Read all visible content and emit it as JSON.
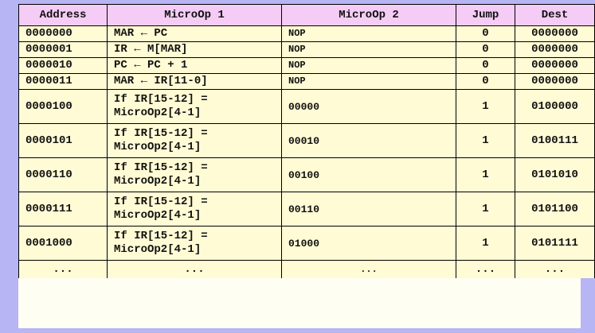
{
  "table": {
    "headers": {
      "address": "Address",
      "microop1": "MicroOp 1",
      "microop2": "MicroOp 2",
      "jump": "Jump",
      "dest": "Dest"
    },
    "rows": [
      {
        "address": "0000000",
        "microop1": "MAR ← PC",
        "microop2": "NOP",
        "jump": "0",
        "dest": "0000000"
      },
      {
        "address": "0000001",
        "microop1": "IR ← M[MAR]",
        "microop2": "NOP",
        "jump": "0",
        "dest": "0000000"
      },
      {
        "address": "0000010",
        "microop1": "PC ← PC + 1",
        "microop2": "NOP",
        "jump": "0",
        "dest": "0000000"
      },
      {
        "address": "0000011",
        "microop1": "MAR ← IR[11-0]",
        "microop2": "NOP",
        "jump": "0",
        "dest": "0000000"
      },
      {
        "address": "0000100",
        "microop1": "If IR[15-12] = MicroOp2[4-1]",
        "microop2": "00000",
        "jump": "1",
        "dest": "0100000"
      },
      {
        "address": "0000101",
        "microop1": "If IR[15-12] = MicroOp2[4-1]",
        "microop2": "00010",
        "jump": "1",
        "dest": "0100111"
      },
      {
        "address": "0000110",
        "microop1": "If IR[15-12] = MicroOp2[4-1]",
        "microop2": "00100",
        "jump": "1",
        "dest": "0101010"
      },
      {
        "address": "0000111",
        "microop1": "If IR[15-12] = MicroOp2[4-1]",
        "microop2": "00110",
        "jump": "1",
        "dest": "0101100"
      },
      {
        "address": "0001000",
        "microop1": "If IR[15-12] = MicroOp2[4-1]",
        "microop2": "01000",
        "jump": "1",
        "dest": "0101111"
      },
      {
        "address": "...",
        "microop1": "...",
        "microop2": "...",
        "jump": "...",
        "dest": "..."
      }
    ]
  }
}
